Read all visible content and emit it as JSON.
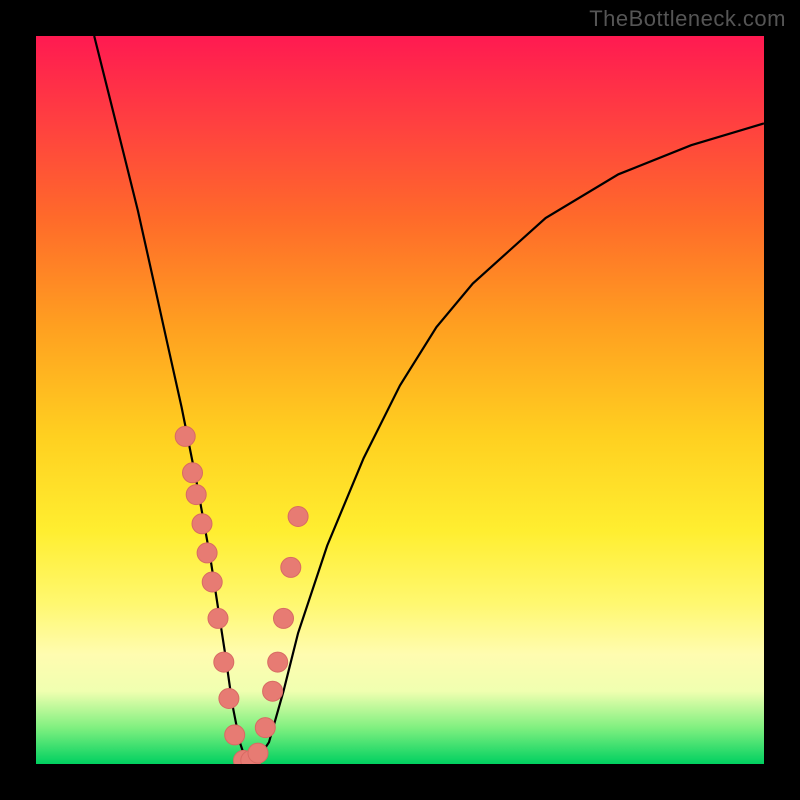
{
  "watermark": "TheBottleneck.com",
  "colors": {
    "frame": "#000000",
    "curve": "#000000",
    "marker_fill": "#e77b73",
    "marker_stroke": "#d86a63",
    "gradient_top": "#ff1a51",
    "gradient_bottom": "#00d060"
  },
  "chart_data": {
    "type": "line",
    "title": "",
    "xlabel": "",
    "ylabel": "",
    "xlim": [
      0,
      100
    ],
    "ylim": [
      0,
      100
    ],
    "series": [
      {
        "name": "bottleneck-curve",
        "x": [
          8,
          10,
          12,
          14,
          16,
          18,
          20,
          22,
          24,
          26,
          27,
          28,
          29,
          30,
          32,
          34,
          36,
          40,
          45,
          50,
          55,
          60,
          70,
          80,
          90,
          100
        ],
        "values": [
          100,
          92,
          84,
          76,
          67,
          58,
          49,
          39,
          28,
          15,
          8,
          3,
          0,
          0,
          3,
          10,
          18,
          30,
          42,
          52,
          60,
          66,
          75,
          81,
          85,
          88
        ]
      }
    ],
    "markers": {
      "name": "highlight-points",
      "x": [
        20.5,
        21.5,
        22.0,
        22.8,
        23.5,
        24.2,
        25.0,
        25.8,
        26.5,
        27.3,
        28.5,
        29.5,
        30.5,
        31.5,
        32.5,
        33.2,
        34.0,
        35.0,
        36.0
      ],
      "values": [
        45.0,
        40.0,
        37.0,
        33.0,
        29.0,
        25.0,
        20.0,
        14.0,
        9.0,
        4.0,
        0.5,
        0.5,
        1.5,
        5.0,
        10.0,
        14.0,
        20.0,
        27.0,
        34.0
      ]
    }
  }
}
